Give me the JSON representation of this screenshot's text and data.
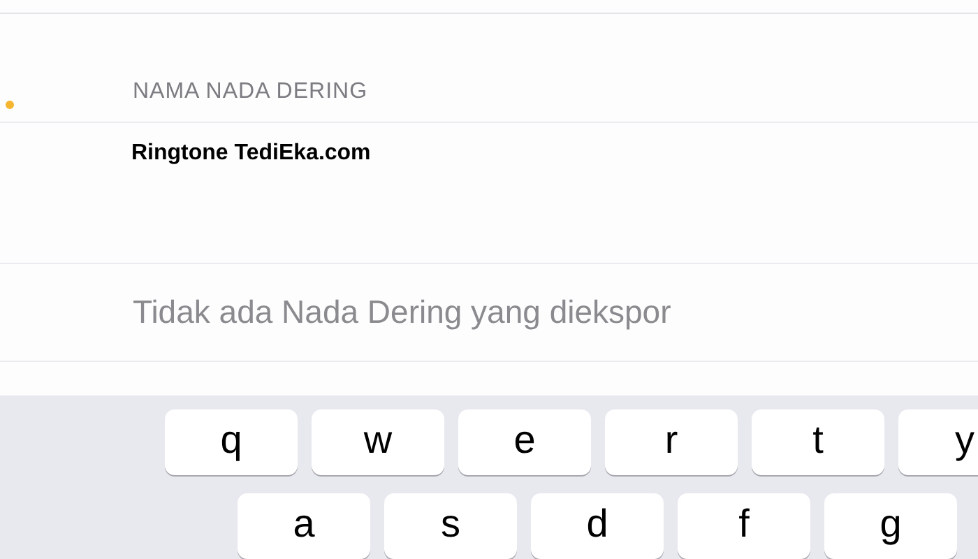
{
  "section_header": "NAMA NADA DERING",
  "name_field": {
    "value": "Ringtone TediEka.com"
  },
  "empty_message": "Tidak ada Nada Dering yang diekspor",
  "keyboard": {
    "rows": [
      [
        "q",
        "w",
        "e",
        "r",
        "t",
        "y"
      ],
      [
        "a",
        "s",
        "d",
        "f",
        "g"
      ]
    ]
  }
}
